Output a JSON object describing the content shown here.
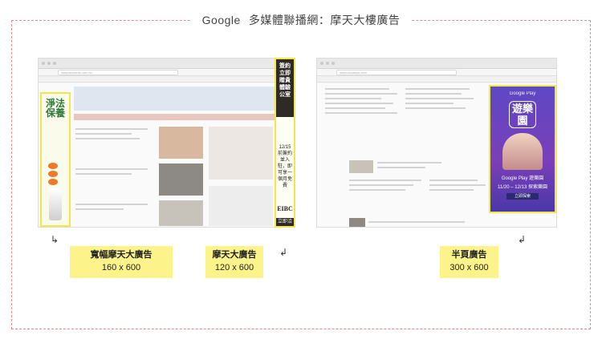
{
  "header": {
    "brand": "Google",
    "subtitle": "多媒體聯播網：摩天大樓廣告"
  },
  "screenshots": {
    "left": {
      "url_text": "www.storeinfo.com.tw"
    },
    "right": {
      "url_text": "www.cloudsys.com"
    }
  },
  "ads": {
    "wide_skyscraper": {
      "vertical_text": "淨法保養",
      "tags": [
        "美白",
        "保濕",
        "抗老"
      ]
    },
    "skyscraper": {
      "headline": "簽約立即贈貴體驗公室",
      "body": "12/15前簽約並入駐，即可享一個月免費",
      "logo": "EIBC",
      "cta": "立即洽詢"
    },
    "half_page": {
      "store": "Google Play",
      "app_name": "遊樂園",
      "line1": "Google Play 遊樂園",
      "line2": "11/20 – 12/13 探索樂園",
      "cta": "立即探索"
    }
  },
  "labels": {
    "wide": {
      "name": "寬幅摩天大廣告",
      "size": "160 x 600"
    },
    "narrow": {
      "name": "摩天大廣告",
      "size": "120 x 600"
    },
    "half": {
      "name": "半頁廣告",
      "size": "300 x 600"
    }
  },
  "arrows": {
    "wide": "↳",
    "narrow": "↲",
    "half": "↲"
  },
  "colors": {
    "frame_border": "#e8898b",
    "label_bg": "#fcf48a",
    "ad_outline": "#f2e64b"
  }
}
